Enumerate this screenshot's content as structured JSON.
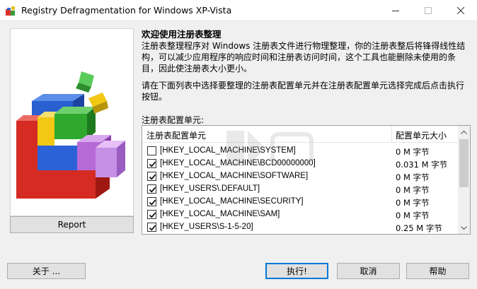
{
  "window": {
    "title": "Registry Defragmentation for Windows XP-Vista",
    "icon": "registry-defrag-app-icon",
    "controls": [
      "minimize",
      "maximize",
      "close"
    ]
  },
  "sidebar": {
    "illustration_icon": "registry-defrag-cubes-illustration",
    "report_label": "Report"
  },
  "content": {
    "welcome": "欢迎使用注册表整理",
    "para1": "注册表整理程序对 Windows 注册表文件进行物理整理，你的注册表整后将锋得线性结构，可以减少应用程序的响应时间和注册表访问时间，这个工具也能删除未使用的条目，因此使注册表大小更小。",
    "para2": "请在下面列表中选择要整理的注册表配置单元并在注册表配置单元选择完成后点击执行按钮。",
    "list_label": "注册表配置单元:"
  },
  "list": {
    "columns": [
      "注册表配置单元",
      "配置单元大小"
    ],
    "rows": [
      {
        "key": "[HKEY_LOCAL_MACHINE\\SYSTEM]",
        "size": "0 M 字节",
        "checked": false
      },
      {
        "key": "[HKEY_LOCAL_MACHINE\\BCD00000000]",
        "size": "0.031 M 字节",
        "checked": true
      },
      {
        "key": "[HKEY_LOCAL_MACHINE\\SOFTWARE]",
        "size": "0 M 字节",
        "checked": true
      },
      {
        "key": "[HKEY_USERS\\.DEFAULT]",
        "size": "0 M 字节",
        "checked": true
      },
      {
        "key": "[HKEY_LOCAL_MACHINE\\SECURITY]",
        "size": "0 M 字节",
        "checked": true
      },
      {
        "key": "[HKEY_LOCAL_MACHINE\\SAM]",
        "size": "0 M 字节",
        "checked": true
      },
      {
        "key": "[HKEY_USERS\\S-1-5-20]",
        "size": "0.25 M 字节",
        "checked": true
      }
    ]
  },
  "buttons": {
    "about": "关于 ...",
    "execute": "执行!",
    "cancel": "取消",
    "help": "帮助"
  },
  "colors": {
    "execute_border": "#0078d7",
    "button_face": "#e1e1e1",
    "window_bg": "#f0f0f0"
  }
}
